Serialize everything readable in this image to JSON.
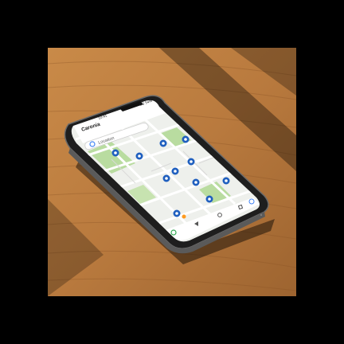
{
  "scene": {
    "description_colors": {
      "background": "#000000",
      "table_wood": "#b97a3e",
      "table_wood_dark": "#8a5426",
      "phone_frame": "#2a2a2a",
      "map_base": "#eef0ec",
      "map_green": "#b9dca0",
      "map_road": "#ffffff",
      "pin_blue": "#1f5fbf",
      "current_location": "#ff9a1f"
    }
  },
  "phone": {
    "status_bar": {
      "left": "10:41",
      "right": "5G 54%"
    },
    "app": {
      "title": "Caronia",
      "search_placeholder": "Location",
      "search_icon": "google-g-icon",
      "nav_icons": [
        "back-icon",
        "home-icon",
        "recents-icon"
      ],
      "bottom_left_icon": "google-g-icon"
    },
    "map": {
      "pin_count_shown": 11
    }
  }
}
